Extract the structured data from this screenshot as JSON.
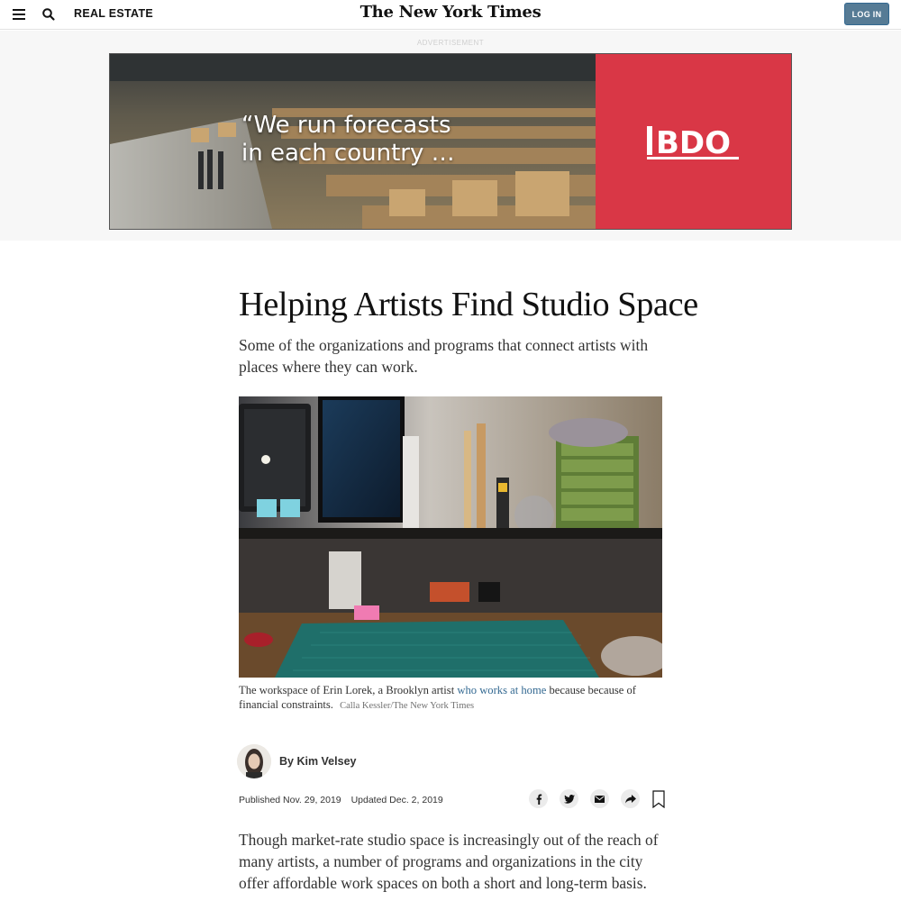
{
  "header": {
    "section": "REAL ESTATE",
    "masthead": "The New York Times",
    "login_label": "LOG IN"
  },
  "ad": {
    "label": "ADVERTISEMENT",
    "headline_line1": "“We run forecasts",
    "headline_line2": "in each country …",
    "brand": "BDO",
    "brand_color": "#d93746"
  },
  "article": {
    "headline": "Helping Artists Find Studio Space",
    "summary": "Some of the organizations and programs that connect artists with places where they can work.",
    "caption_before": "The workspace of Erin Lorek, a Brooklyn artist ",
    "caption_link": "who works at home",
    "caption_after": " because because of financial constraints.",
    "credit": "Calla Kessler/The New York Times",
    "byline": "By Kim Velsey",
    "published": "Published Nov. 29, 2019",
    "updated": "Updated Dec. 2, 2019",
    "body": "Though market-rate studio space is increasingly out of the reach of many artists, a number of programs and organizations in the city offer affordable work spaces on both a short and long-term basis."
  },
  "share": {
    "icons": [
      "facebook-icon",
      "twitter-icon",
      "email-icon",
      "share-icon",
      "bookmark-icon"
    ]
  },
  "colors": {
    "link": "#326891",
    "login_bg": "#567b95"
  }
}
